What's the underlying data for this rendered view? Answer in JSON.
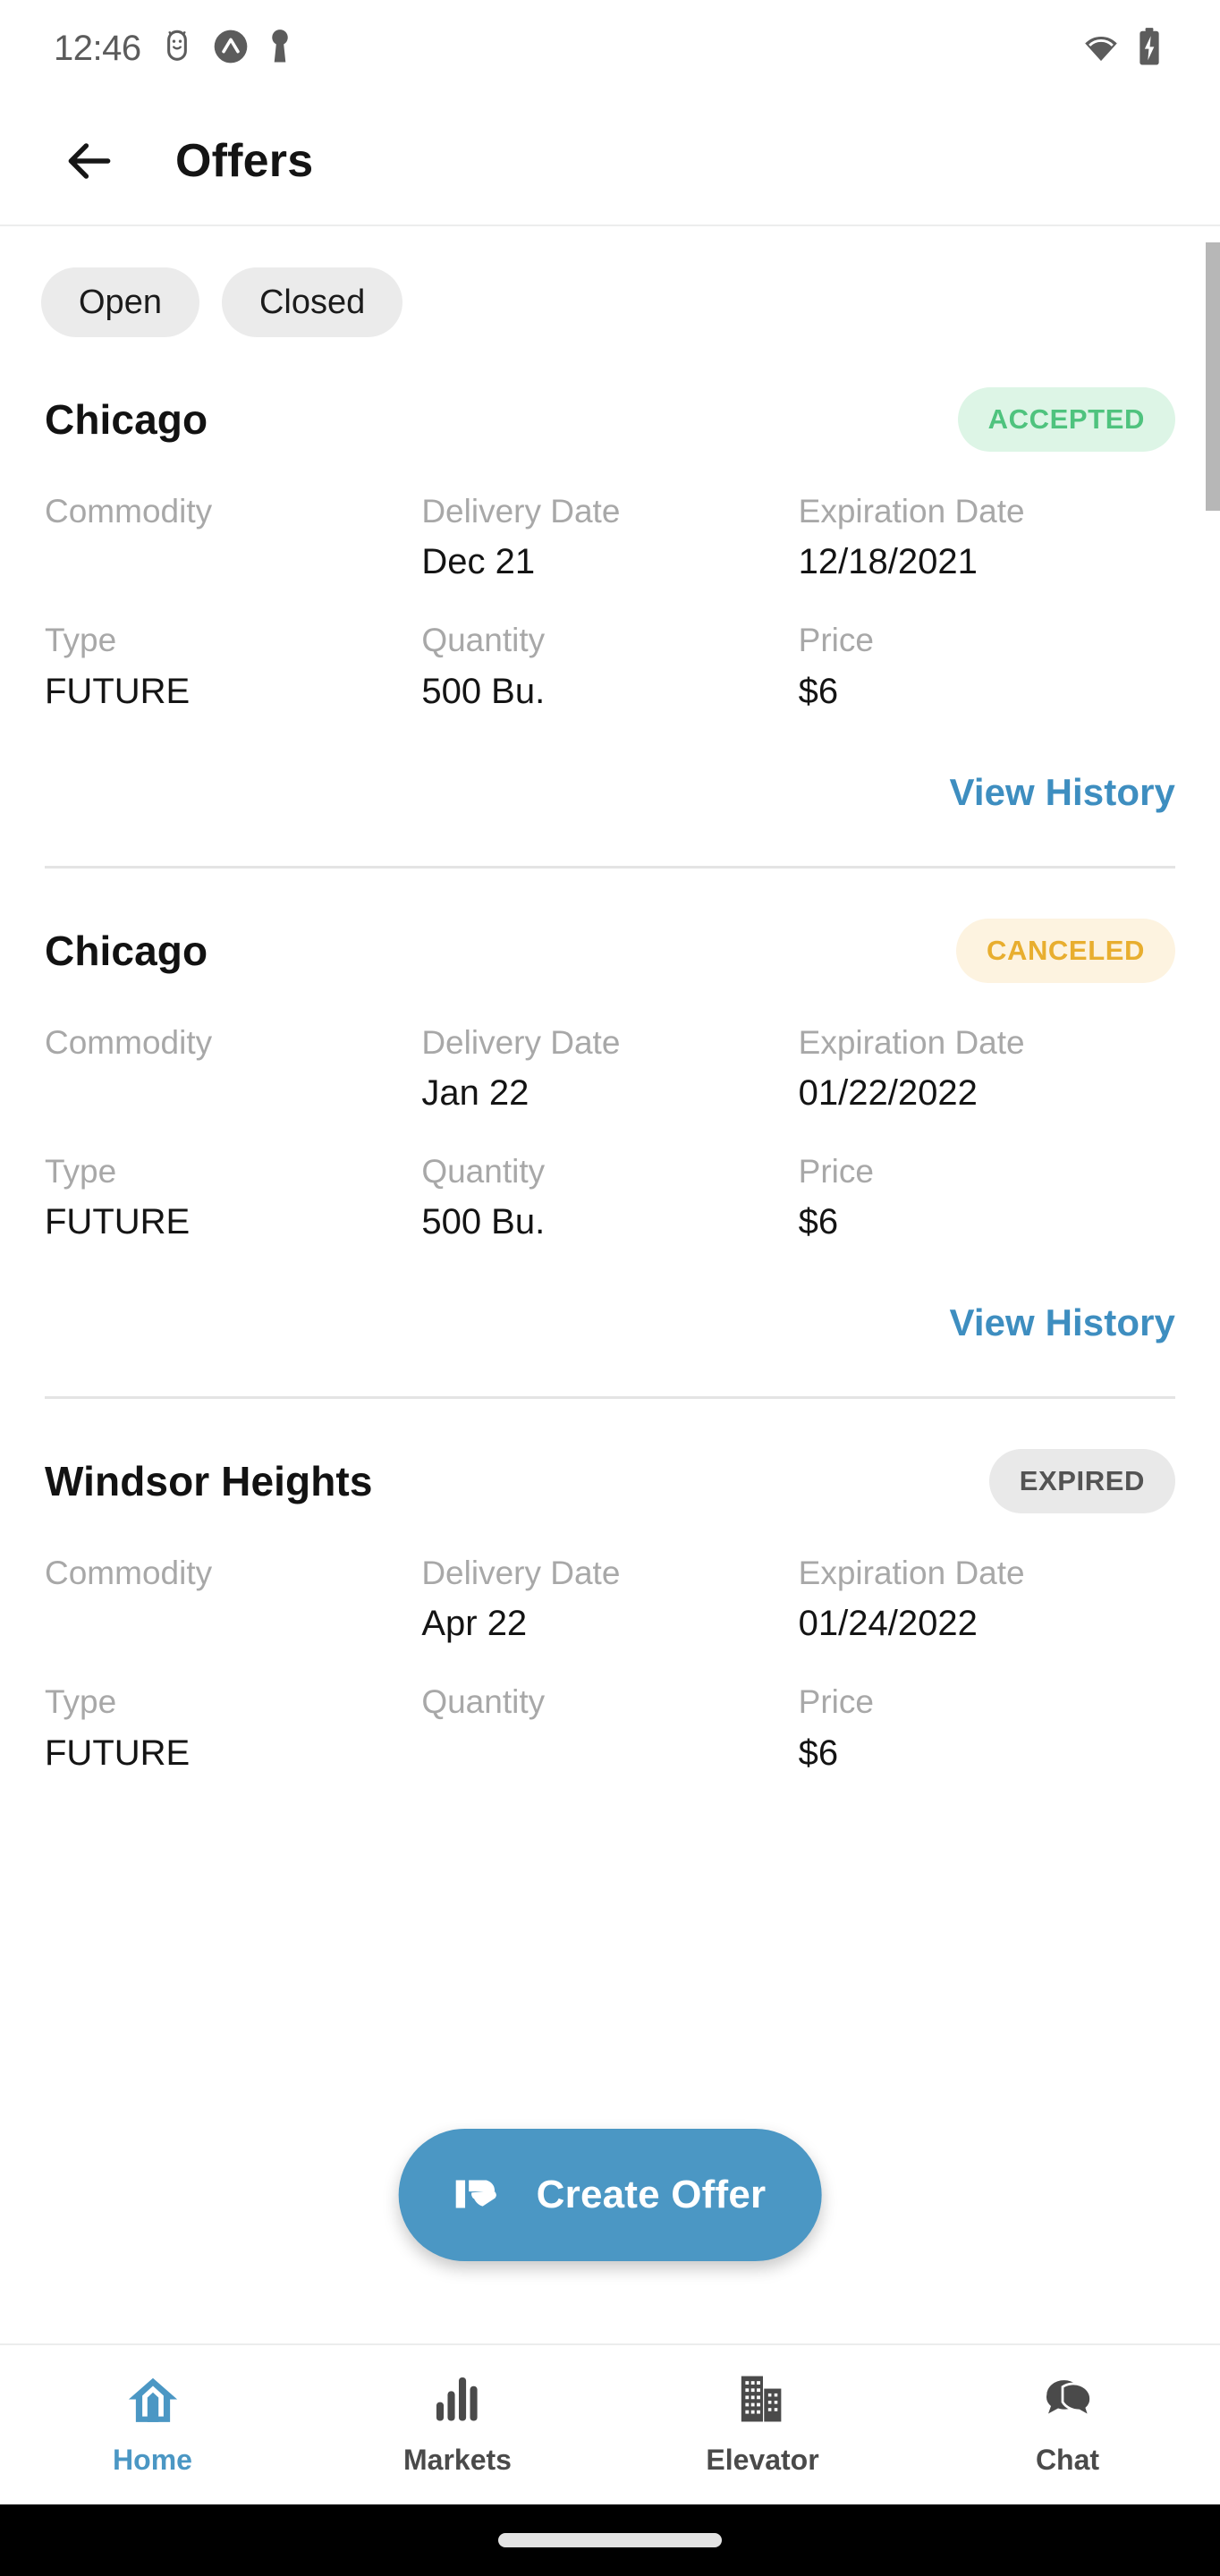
{
  "status_bar": {
    "time": "12:46",
    "left_icons": [
      "android-debug-icon",
      "app-badge-icon",
      "key-icon"
    ],
    "right_icons": [
      "wifi-icon",
      "battery-charging-icon"
    ]
  },
  "app_bar": {
    "back_icon": "arrow-left-icon",
    "title": "Offers"
  },
  "filters": {
    "chips": [
      {
        "label": "Open",
        "selected": false
      },
      {
        "label": "Closed",
        "selected": false
      }
    ]
  },
  "field_labels": {
    "commodity": "Commodity",
    "delivery_date": "Delivery Date",
    "expiration_date": "Expiration Date",
    "type": "Type",
    "quantity": "Quantity",
    "price": "Price"
  },
  "links": {
    "view_history": "View History"
  },
  "offers": [
    {
      "location": "Chicago",
      "status": "ACCEPTED",
      "status_kind": "accepted",
      "commodity": "",
      "delivery_date": "Dec 21",
      "expiration_date": "12/18/2021",
      "type": "FUTURE",
      "quantity": "500 Bu.",
      "price": "$6",
      "has_view_history": true
    },
    {
      "location": "Chicago",
      "status": "CANCELED",
      "status_kind": "canceled",
      "commodity": "",
      "delivery_date": "Jan 22",
      "expiration_date": "01/22/2022",
      "type": "FUTURE",
      "quantity": "500 Bu.",
      "price": "$6",
      "has_view_history": true
    },
    {
      "location": "Windsor Heights",
      "status": "EXPIRED",
      "status_kind": "expired",
      "commodity": "",
      "delivery_date": "Apr 22",
      "expiration_date": "01/24/2022",
      "type": "FUTURE",
      "quantity": "",
      "price": "$6",
      "has_view_history": false
    }
  ],
  "fab": {
    "label": "Create Offer",
    "icon": "hand-offer-icon",
    "color": "#4b97c4"
  },
  "bottom_nav": {
    "items": [
      {
        "label": "Home",
        "icon": "home-icon",
        "active": true
      },
      {
        "label": "Markets",
        "icon": "bar-chart-icon",
        "active": false
      },
      {
        "label": "Elevator",
        "icon": "buildings-icon",
        "active": false
      },
      {
        "label": "Chat",
        "icon": "chat-bubbles-icon",
        "active": false
      }
    ]
  },
  "colors": {
    "accent_blue": "#4b97c4",
    "link_blue": "#3e8ec0",
    "accepted_bg": "#ddf5e6",
    "accepted_fg": "#4fc37e",
    "canceled_bg": "#fdf3e0",
    "canceled_fg": "#e8ae2f",
    "expired_bg": "#e9e9e9",
    "expired_fg": "#535353",
    "chip_bg": "#ebebeb",
    "label_gray": "#a8a8a8"
  }
}
